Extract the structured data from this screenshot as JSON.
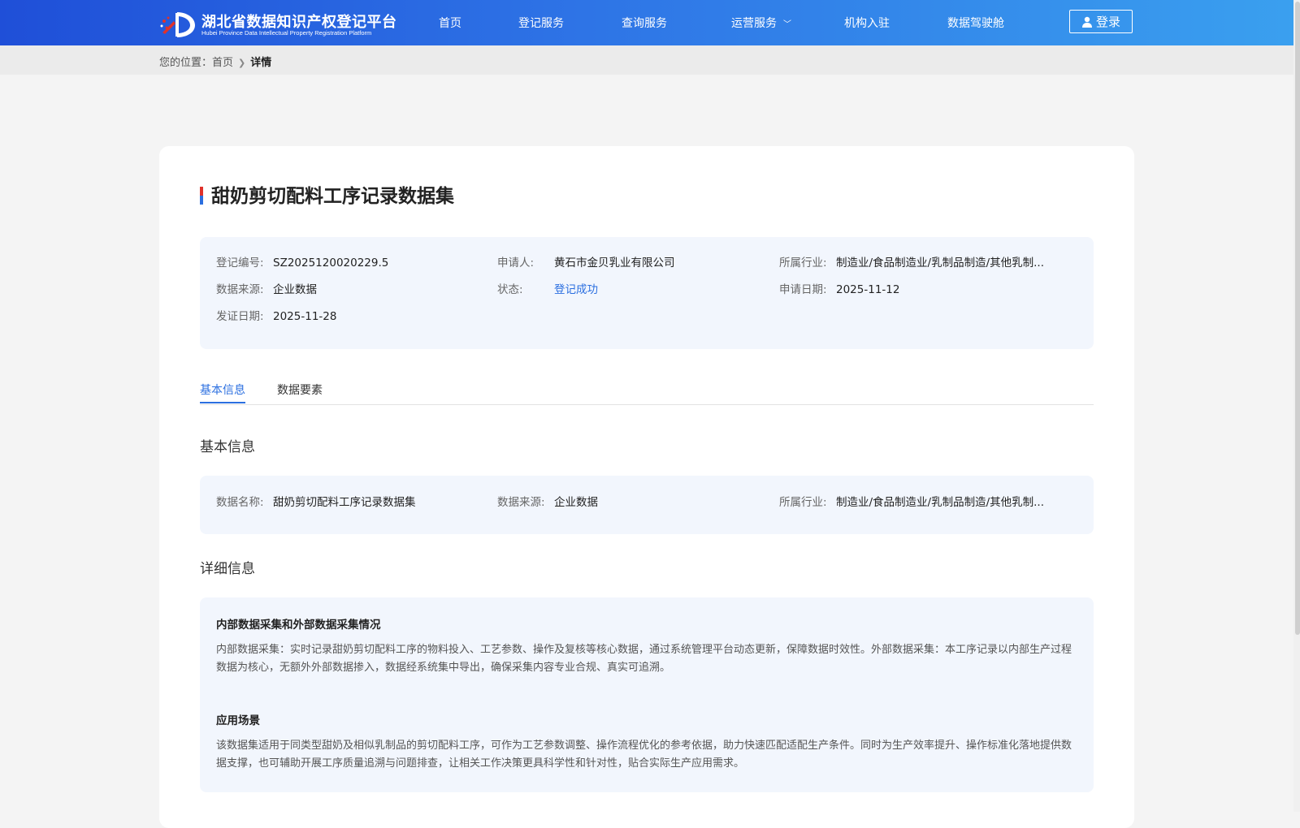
{
  "header": {
    "logo_title": "湖北省数据知识产权登记平台",
    "logo_subtitle": "Hubei Province Data Intellectual Property Registration Platform",
    "nav": [
      {
        "label": "首页"
      },
      {
        "label": "登记服务"
      },
      {
        "label": "查询服务"
      },
      {
        "label": "运营服务",
        "has_dropdown": true
      },
      {
        "label": "机构入驻"
      },
      {
        "label": "数据驾驶舱"
      }
    ],
    "login_label": "登录",
    "colors": {
      "gradient_start": "#1f4fd8",
      "gradient_end": "#3aa0ef"
    }
  },
  "breadcrumb": {
    "prefix": "您的位置：",
    "home": "首页",
    "current": "详情"
  },
  "detail": {
    "title": "甜奶剪切配料工序记录数据集",
    "summary": {
      "reg_no_label": "登记编号:",
      "reg_no": "SZ2025120020229.5",
      "applicant_label": "申请人:",
      "applicant": "黄石市金贝乳业有限公司",
      "industry_label": "所属行业:",
      "industry": "制造业/食品制造业/乳制品制造/其他乳制...",
      "source_label": "数据来源:",
      "source": "企业数据",
      "status_label": "状态:",
      "status": "登记成功",
      "apply_date_label": "申请日期:",
      "apply_date": "2025-11-12",
      "issue_date_label": "发证日期:",
      "issue_date": "2025-11-28"
    },
    "tabs": [
      {
        "label": "基本信息",
        "active": true
      },
      {
        "label": "数据要素",
        "active": false
      }
    ],
    "basic_section": {
      "heading": "基本信息",
      "name_label": "数据名称:",
      "name": "甜奶剪切配料工序记录数据集",
      "source_label": "数据来源:",
      "source": "企业数据",
      "industry_label": "所属行业:",
      "industry": "制造业/食品制造业/乳制品制造/其他乳制..."
    },
    "detail_section": {
      "heading": "详细信息",
      "items": [
        {
          "title": "内部数据采集和外部数据采集情况",
          "text": "内部数据采集：实时记录甜奶剪切配料工序的物料投入、工艺参数、操作及复核等核心数据，通过系统管理平台动态更新，保障数据时效性。外部数据采集：本工序记录以内部生产过程数据为核心，无额外外部数据掺入，数据经系统集中导出，确保采集内容专业合规、真实可追溯。"
        },
        {
          "title": "应用场景",
          "text": "该数据集适用于同类型甜奶及相似乳制品的剪切配料工序，可作为工艺参数调整、操作流程优化的参考依据，助力快速匹配适配生产条件。同时为生产效率提升、操作标准化落地提供数据支撑，也可辅助开展工序质量追溯与问题排查，让相关工作决策更具科学性和针对性，贴合实际生产应用需求。"
        }
      ]
    },
    "colors": {
      "accent": "#2b6fe0",
      "panel_bg": "#f2f6fd",
      "title_bar_red": "#e0322b",
      "title_bar_blue": "#2b6fe0"
    }
  }
}
